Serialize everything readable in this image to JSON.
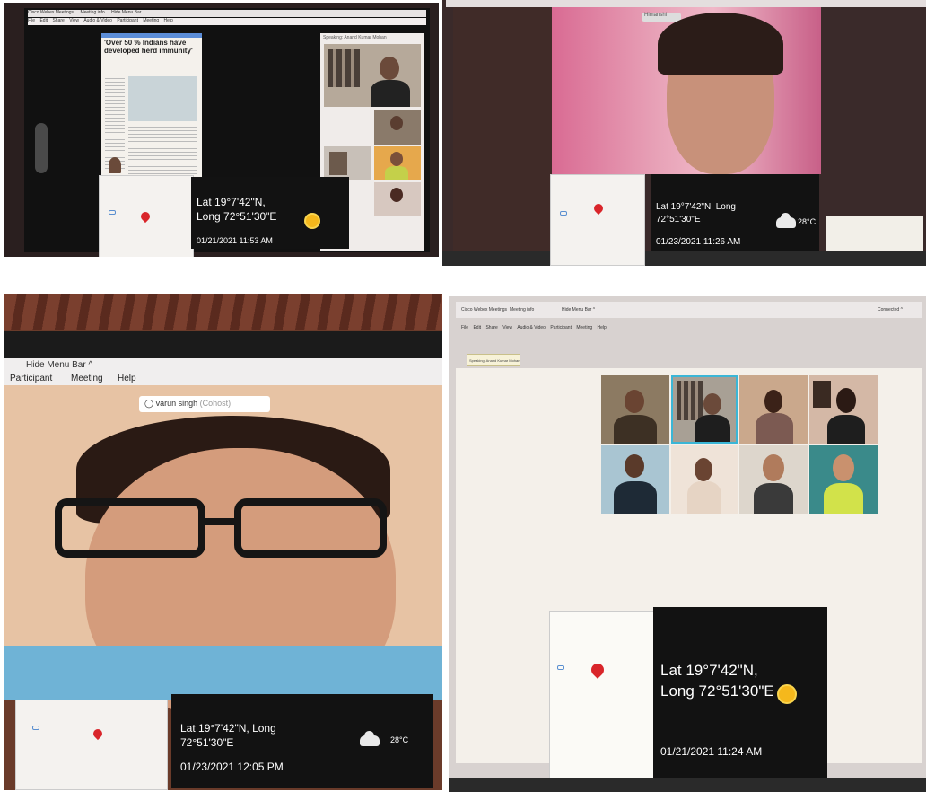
{
  "captures": [
    {
      "menu_tabs": [
        "Cisco Webex Meetings",
        "Meeting info",
        "Hide Menu Bar"
      ],
      "menu_items": [
        "File",
        "Edit",
        "Share",
        "View",
        "Audio & Video",
        "Participant",
        "Meeting",
        "Help"
      ],
      "newspaper_headline": "'Over 50 % Indians have developed herd immunity'",
      "speaker_label": "Speaking: Anand Kumar Mohan",
      "gps": {
        "coords": "Lat 19°7'42\"N,\nLong 72°51'30\"E",
        "timestamp": "01/21/2021 11:53 AM",
        "weather_icon": "sun-icon"
      }
    },
    {
      "participant_name": "Himanshi",
      "gps": {
        "coords": "Lat 19°7'42\"N, Long\n72°51'30\"E",
        "timestamp": "01/23/2021 11:26 AM",
        "temperature": "28°C",
        "weather_icon": "cloud-icon"
      }
    },
    {
      "menu_hide": "Hide Menu Bar ^",
      "menu_items": [
        "Participant",
        "Meeting",
        "Help"
      ],
      "participant_name": "varun singh",
      "participant_role": "(Cohost)",
      "gps": {
        "coords": "Lat 19°7'42\"N, Long\n72°51'30\"E",
        "timestamp": "01/23/2021 12:05 PM",
        "temperature": "28°C",
        "weather_icon": "cloud-icon"
      }
    },
    {
      "menu_tabs": [
        "Cisco Webex Meetings",
        "Meeting info",
        "Hide Menu Bar ^"
      ],
      "menu_items": [
        "File",
        "Edit",
        "Share",
        "View",
        "Audio & Video",
        "Participant",
        "Meeting",
        "Help"
      ],
      "connect_label": "Connected ^",
      "speaker_label": "Speaking: Anand Kumar Mohan",
      "gps": {
        "coords": "Lat 19°7'42\"N,\nLong 72°51'30\"E",
        "timestamp": "01/21/2021 11:24 AM",
        "weather_icon": "sun-icon"
      }
    }
  ],
  "colors": {
    "gps_box": "#121212",
    "pin": "#d9252a",
    "sun": "#f5b81c"
  }
}
